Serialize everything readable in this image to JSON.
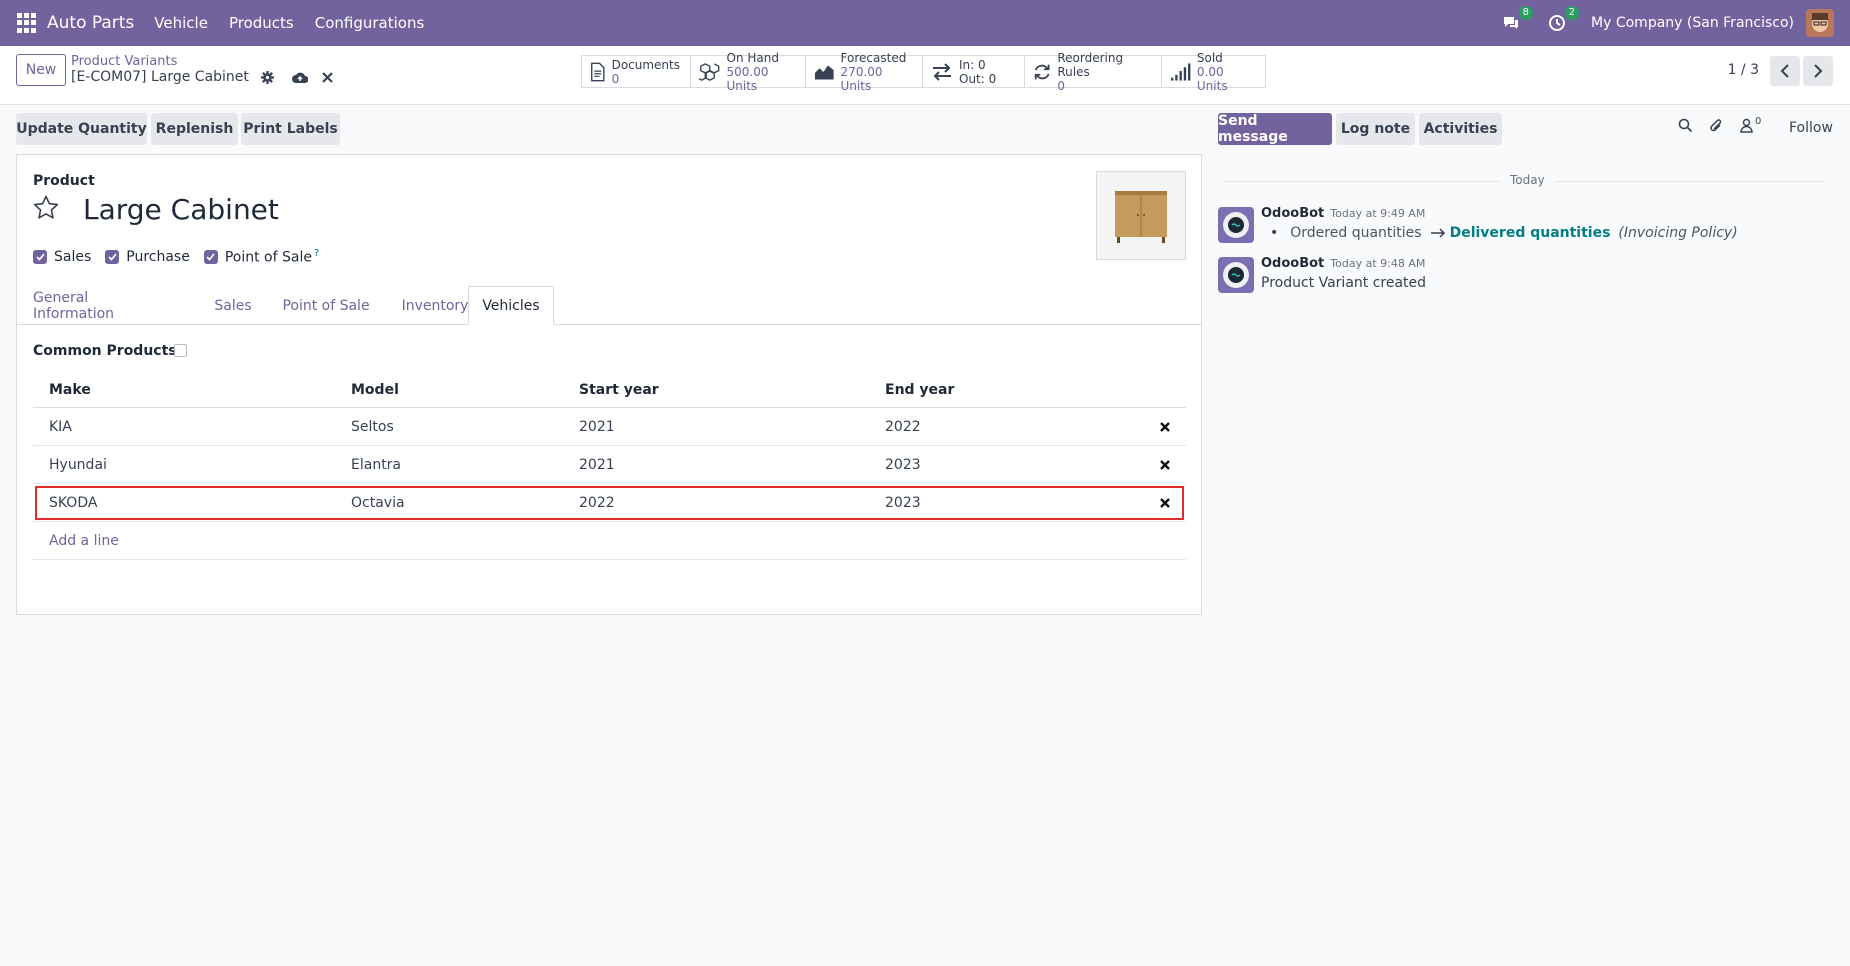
{
  "topbar": {
    "brand": "Auto Parts",
    "menus": [
      "Vehicle",
      "Products",
      "Configurations"
    ],
    "messages_count": "8",
    "activities_count": "2",
    "company": "My Company (San Francisco)"
  },
  "control": {
    "new_label": "New",
    "breadcrumb_parent": "Product Variants",
    "breadcrumb_current": "[E-COM07] Large Cabinet",
    "pager": "1 / 3"
  },
  "stats": [
    {
      "label": "Documents",
      "value": "0"
    },
    {
      "label": "On Hand",
      "value": "500.00 Units"
    },
    {
      "label": "Forecasted",
      "value": "270.00 Units"
    },
    {
      "label": "In: 0",
      "value": "Out: 0"
    },
    {
      "label": "Reordering Rules",
      "value": "0"
    },
    {
      "label": "Sold",
      "value": "0.00 Units"
    }
  ],
  "actions": [
    "Update Quantity",
    "Replenish",
    "Print Labels"
  ],
  "form": {
    "product_label": "Product",
    "product_name": "Large Cabinet",
    "checkboxes": [
      {
        "label": "Sales",
        "checked": true
      },
      {
        "label": "Purchase",
        "checked": true
      },
      {
        "label": "Point of Sale",
        "checked": true
      }
    ],
    "help_mark": "?",
    "tabs": [
      "General Information",
      "Sales",
      "Point of Sale",
      "Inventory",
      "Vehicles"
    ],
    "active_tab": "Vehicles",
    "common_products_label": "Common Products?",
    "common_products_checked": false
  },
  "vehicles_table": {
    "headers": [
      "Make",
      "Model",
      "Start year",
      "End year"
    ],
    "rows": [
      [
        "KIA",
        "Seltos",
        "2021",
        "2022"
      ],
      [
        "Hyundai",
        "Elantra",
        "2021",
        "2023"
      ],
      [
        "SKODA",
        "Octavia",
        "2022",
        "2023"
      ]
    ],
    "add_line": "Add a line"
  },
  "chatter": {
    "send_message": "Send message",
    "log_note": "Log note",
    "activities": "Activities",
    "followers_count": "0",
    "follow": "Follow",
    "date_separator": "Today",
    "messages": [
      {
        "author": "OdooBot",
        "time": "Today at 9:49 AM",
        "old_value": "Ordered quantities",
        "new_value": "Delivered quantities",
        "field": "(Invoicing Policy)"
      },
      {
        "author": "OdooBot",
        "time": "Today at 9:48 AM",
        "body": "Product Variant created"
      }
    ]
  },
  "colors": {
    "brand": "#71639e",
    "link": "#017e84",
    "badge": "#2a9d61",
    "highlight": "#e32a2a"
  }
}
